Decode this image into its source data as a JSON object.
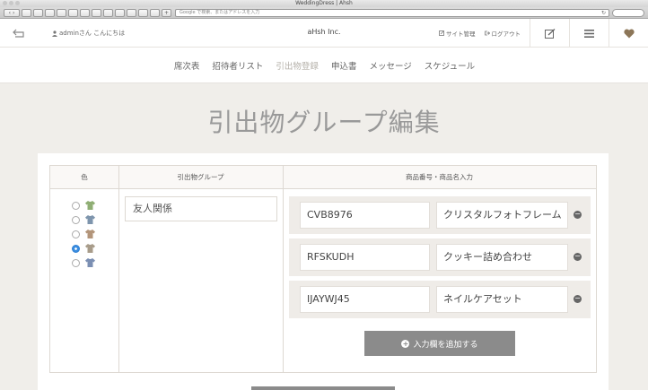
{
  "browser": {
    "window_title": "WeddingDress | Ahsh",
    "address_placeholder": "Google で検索、またはアドレスを入力",
    "reload_icon": "↻"
  },
  "header": {
    "greeting": "adminさん こんにちは",
    "brand": "aHsh Inc.",
    "site_admin": "サイト管理",
    "logout": "ログアウト"
  },
  "nav": {
    "items": [
      {
        "label": "席次表"
      },
      {
        "label": "招待者リスト"
      },
      {
        "label": "引出物登録"
      },
      {
        "label": "申込書"
      },
      {
        "label": "メッセージ"
      },
      {
        "label": "スケジュール"
      }
    ],
    "active_index": 2
  },
  "page": {
    "title": "引出物グループ編集"
  },
  "table": {
    "headers": {
      "color": "色",
      "group": "引出物グループ",
      "items": "商品番号・商品名入力"
    },
    "group_name": "友人関係",
    "color_options": [
      {
        "color": "#8fae74",
        "selected": false
      },
      {
        "color": "#7e95ad",
        "selected": false
      },
      {
        "color": "#b3957a",
        "selected": false
      },
      {
        "color": "#a89c8a",
        "selected": true
      },
      {
        "color": "#7b8fb3",
        "selected": false
      }
    ],
    "products": [
      {
        "code": "CVB8976",
        "name": "クリスタルフォトフレーム"
      },
      {
        "code": "RFSKUDH",
        "name": "クッキー詰め合わせ"
      },
      {
        "code": "IJAYWJ45",
        "name": "ネイルケアセット"
      }
    ],
    "add_button": "入力欄を追加する"
  }
}
